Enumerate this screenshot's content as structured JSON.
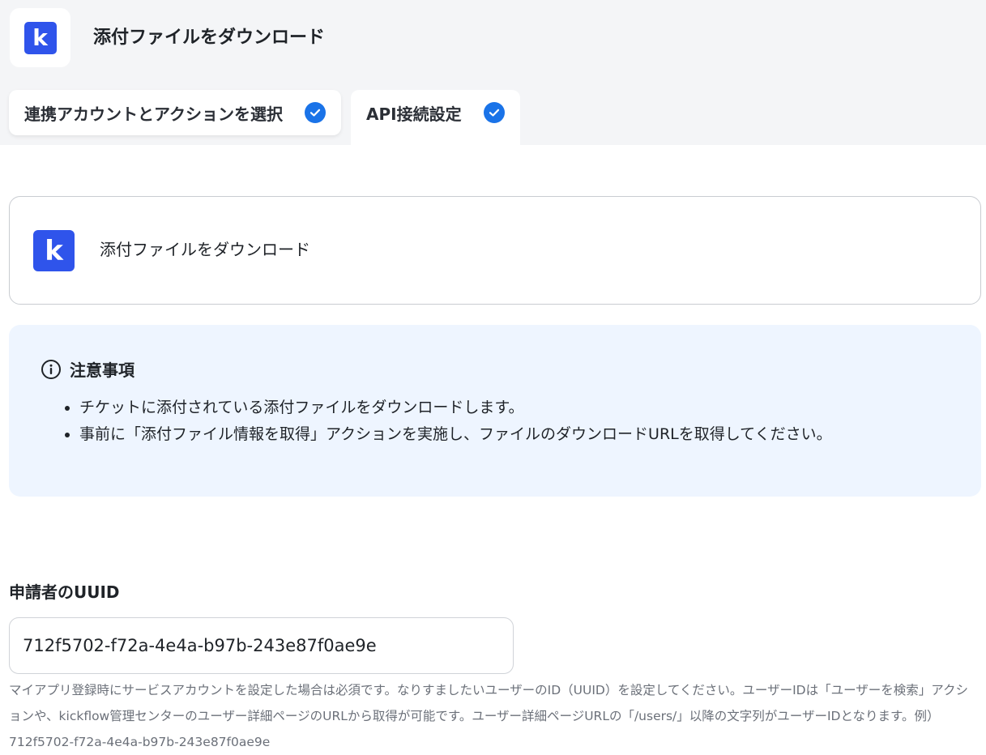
{
  "header": {
    "title": "添付ファイルをダウンロード"
  },
  "tabs": [
    {
      "label": "連携アカウントとアクションを選択",
      "completed": true
    },
    {
      "label": "API接続設定",
      "completed": true
    }
  ],
  "action_card": {
    "title": "添付ファイルをダウンロード"
  },
  "notice": {
    "heading": "注意事項",
    "items": [
      "チケットに添付されている添付ファイルをダウンロードします。",
      "事前に「添付ファイル情報を取得」アクションを実施し、ファイルのダウンロードURLを取得してください。"
    ]
  },
  "field": {
    "label": "申請者のUUID",
    "value": "712f5702-f72a-4e4a-b97b-243e87f0ae9e",
    "help": "マイアプリ登録時にサービスアカウントを設定した場合は必須です。なりすましたいユーザーのID（UUID）を設定してください。ユーザーIDは「ユーザーを検索」アクションや、kickflow管理センターのユーザー詳細ページのURLから取得が可能です。ユーザー詳細ページURLの「/users/」以降の文字列がユーザーIDとなります。例）712f5702-f72a-4e4a-b97b-243e87f0ae9e"
  },
  "logo_letter": "k",
  "colors": {
    "brand": "#2f54eb",
    "check": "#1a73e8",
    "notice_bg": "#eef5ff"
  }
}
